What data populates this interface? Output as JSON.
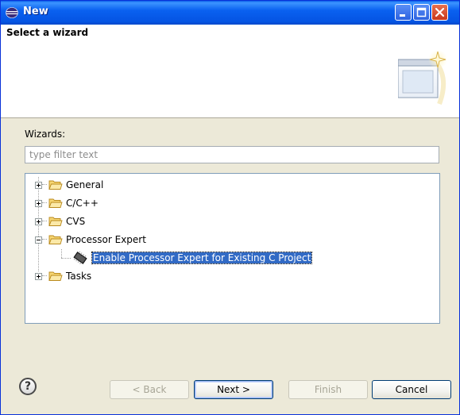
{
  "window": {
    "title": "New",
    "title_bar_color": "#0554e3",
    "close_button_color": "#c8391c"
  },
  "header": {
    "title": "Select a wizard"
  },
  "wizards": {
    "label": "Wizards:",
    "filter_placeholder": "type filter text",
    "filter_value": ""
  },
  "tree": {
    "items": [
      {
        "label": "General",
        "icon": "folder-icon",
        "expanded": false,
        "level": 0
      },
      {
        "label": "C/C++",
        "icon": "folder-icon",
        "expanded": false,
        "level": 0
      },
      {
        "label": "CVS",
        "icon": "folder-icon",
        "expanded": false,
        "level": 0
      },
      {
        "label": "Processor Expert",
        "icon": "folder-icon",
        "expanded": true,
        "level": 0
      },
      {
        "label": "Enable Processor Expert for Existing C Project",
        "icon": "chip-icon",
        "expanded": null,
        "level": 1,
        "selected": true
      },
      {
        "label": "Tasks",
        "icon": "folder-icon",
        "expanded": false,
        "level": 0
      }
    ],
    "selection_color": "#316ac5"
  },
  "footer": {
    "help_label": "?",
    "back_label": "< Back",
    "next_label": "Next >",
    "finish_label": "Finish",
    "cancel_label": "Cancel"
  }
}
